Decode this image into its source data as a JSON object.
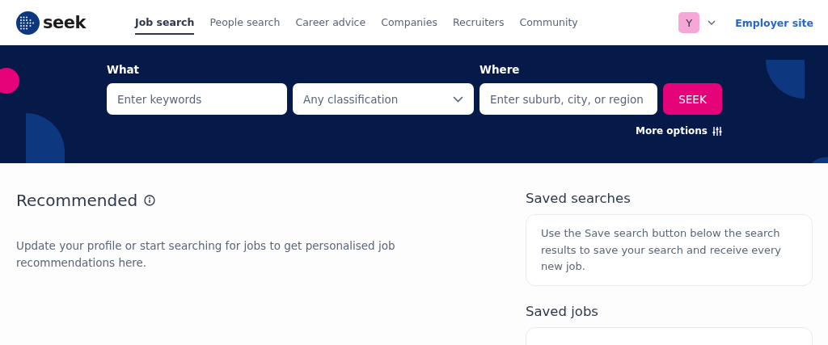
{
  "header": {
    "logo": "seek",
    "nav": [
      {
        "label": "Job search",
        "selected": true
      },
      {
        "label": "People search",
        "selected": false
      },
      {
        "label": "Career advice",
        "selected": false
      },
      {
        "label": "Companies",
        "selected": false
      },
      {
        "label": "Recruiters",
        "selected": false
      },
      {
        "label": "Community",
        "selected": false
      }
    ],
    "avatar": "Y",
    "employer_link": "Employer site"
  },
  "search": {
    "what_label": "What",
    "keywords_placeholder": "Enter keywords",
    "classification": "Any classification",
    "where_label": "Where",
    "where_placeholder": "Enter suburb, city, or region",
    "button": "SEEK",
    "more_options": "More options"
  },
  "recommended": {
    "title": "Recommended",
    "link": "Update your profile",
    "text": " or start searching for jobs to get personalised job recommendations here."
  },
  "saved_searches": {
    "title": "Saved searches",
    "text": "Use the Save search button below the search results to save your search and receive every new job."
  },
  "saved_jobs": {
    "title": "Saved jobs"
  }
}
